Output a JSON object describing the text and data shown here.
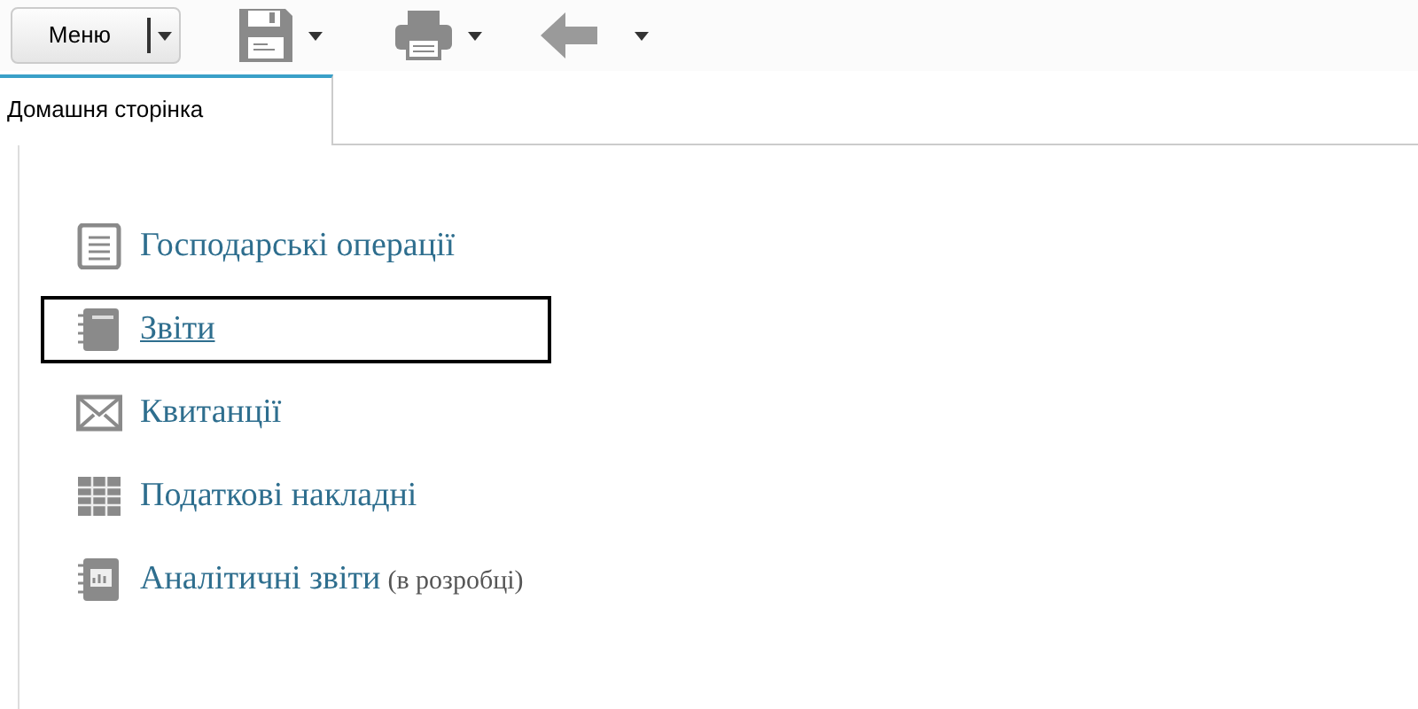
{
  "toolbar": {
    "menu_button": "Меню"
  },
  "tabs": [
    {
      "label": "Домашня сторінка",
      "selected": true
    }
  ],
  "items": [
    {
      "kind": "document",
      "label": "Господарські операції",
      "selected": false
    },
    {
      "kind": "notebook",
      "label": "Звіти",
      "selected": true
    },
    {
      "kind": "envelope",
      "label": "Квитанції",
      "selected": false
    },
    {
      "kind": "table",
      "label": "Податкові накладні",
      "selected": false
    },
    {
      "kind": "chart-notebook",
      "label": "Аналітичні звіти",
      "note": "(в розробці)",
      "selected": false
    }
  ]
}
